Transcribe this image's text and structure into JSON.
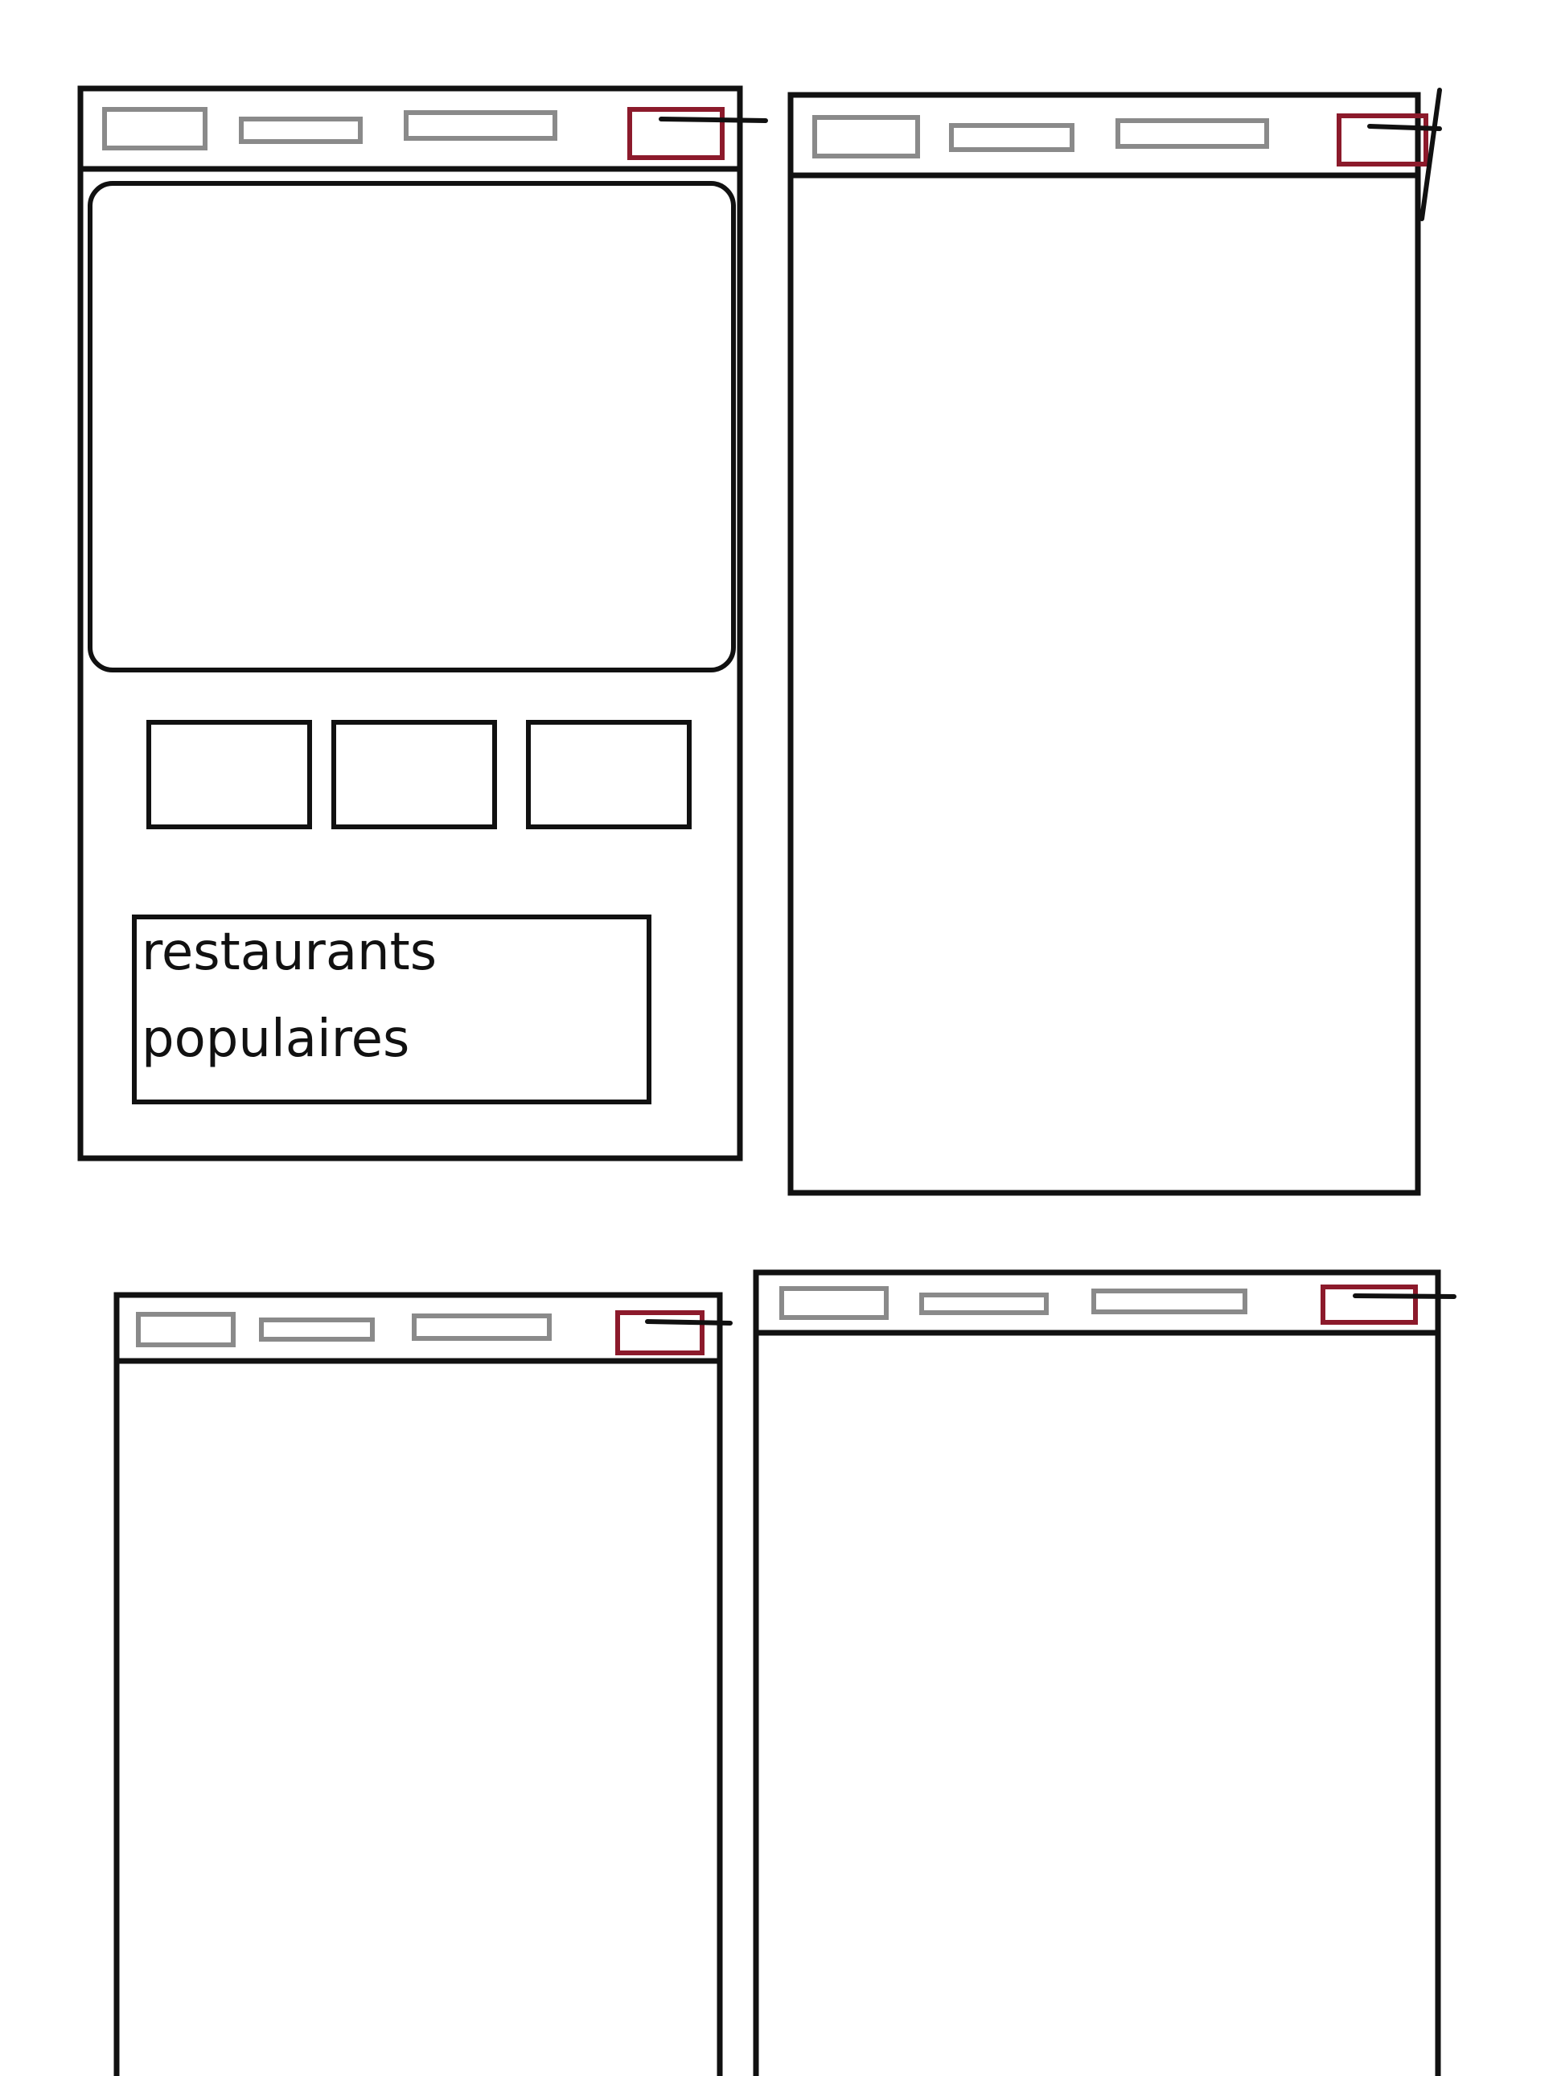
{
  "wireframes": [
    {
      "id": "screen-1",
      "has_hero": true,
      "thumbnail_count": 3,
      "section_label_lines": [
        "restaurants",
        "populaires"
      ]
    },
    {
      "id": "screen-2",
      "has_hero": false
    },
    {
      "id": "screen-3",
      "has_hero": false
    },
    {
      "id": "screen-4",
      "has_hero": false
    }
  ],
  "nav": {
    "item_count": 3,
    "item_color": "#8a8a8a",
    "accent_color": "#8c1a2b",
    "accent_item": "menu-button"
  },
  "colors": {
    "stroke": "#111111",
    "background": "#ffffff"
  }
}
